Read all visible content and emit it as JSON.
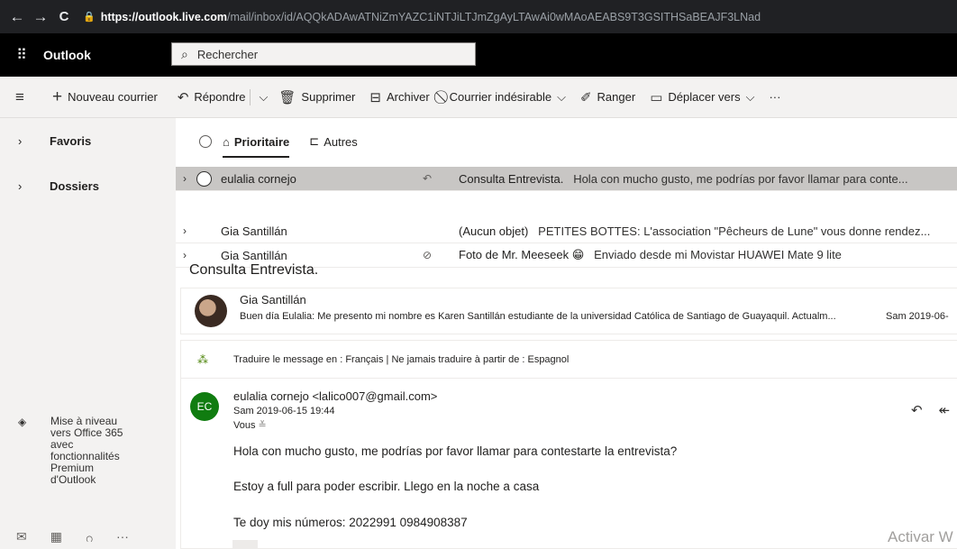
{
  "browser": {
    "back_icon": "←",
    "forward_icon": "→",
    "reload_icon": "C",
    "url_host": "https://outlook.live.com",
    "url_path": "/mail/inbox/id/AQQkADAwATNiZmYAZC1iNTJiLTJmZgAyLTAwAi0wMAoAEABS9T3GSITHSaBEAJF3LNad"
  },
  "app": {
    "name": "Outlook",
    "search_placeholder": "Rechercher"
  },
  "commands": {
    "new_mail": "Nouveau courrier",
    "reply": "Répondre",
    "delete": "Supprimer",
    "archive": "Archiver",
    "junk": "Courrier indésirable",
    "sweep": "Ranger",
    "move": "Déplacer vers",
    "more": "···"
  },
  "nav": {
    "favorites": "Favoris",
    "folders": "Dossiers",
    "upgrade": [
      "Mise à niveau",
      "vers Office 365",
      "avec",
      "fonctionnalités",
      "Premium",
      "d'Outlook"
    ],
    "bottom_more": "···"
  },
  "pivots": {
    "focused": "Prioritaire",
    "other": "Autres"
  },
  "messages": [
    {
      "from": "eulalia cornejo",
      "subject": "Consulta Entrevista.",
      "preview": "Hola con mucho gusto, me podrías por favor llamar para conte...",
      "selected": true,
      "replied_icon": "reply-icon"
    },
    {
      "from": "Gia Santillán",
      "subject": "(Aucun objet)",
      "preview": "PETITES BOTTES: L'association \"Pêcheurs de Lune\" vous donne rendez...",
      "selected": false
    },
    {
      "from": "Gia Santillán",
      "subject": "Foto de Mr. Meeseek 😁",
      "preview": "Enviado desde mi Movistar HUAWEI Mate 9 lite",
      "selected": false,
      "attachment_icon": "paperclip-icon"
    }
  ],
  "reading": {
    "title": "Consulta Entrevista.",
    "collapsed": {
      "sender": "Gia Santillán",
      "snippet": "Buen día Eulalia: Me presento mi nombre es Karen Santillán estudiante de la universidad Católica de Santiago de Guayaquil. Actualm...",
      "date": "Sam 2019-06-"
    },
    "translate": "Traduire le message en : Français | Ne jamais traduire à partir de : Espagnol",
    "expanded": {
      "avatar_initials": "EC",
      "from": "eulalia cornejo <lalico007@gmail.com>",
      "date": "Sam 2019-06-15 19:44",
      "to": "Vous",
      "body": [
        "Hola con mucho gusto, me podrías por favor llamar para contestarte  la entrevista?",
        "Estoy a full para poder escribir. Llego en la noche a casa",
        "Te doy mis números: 2022991  0984908387"
      ]
    }
  },
  "watermark": "Activar W",
  "colors": {
    "app_bar": "#000000",
    "avatar_ec": "#107c10",
    "selected_row": "#c8c6c4"
  }
}
